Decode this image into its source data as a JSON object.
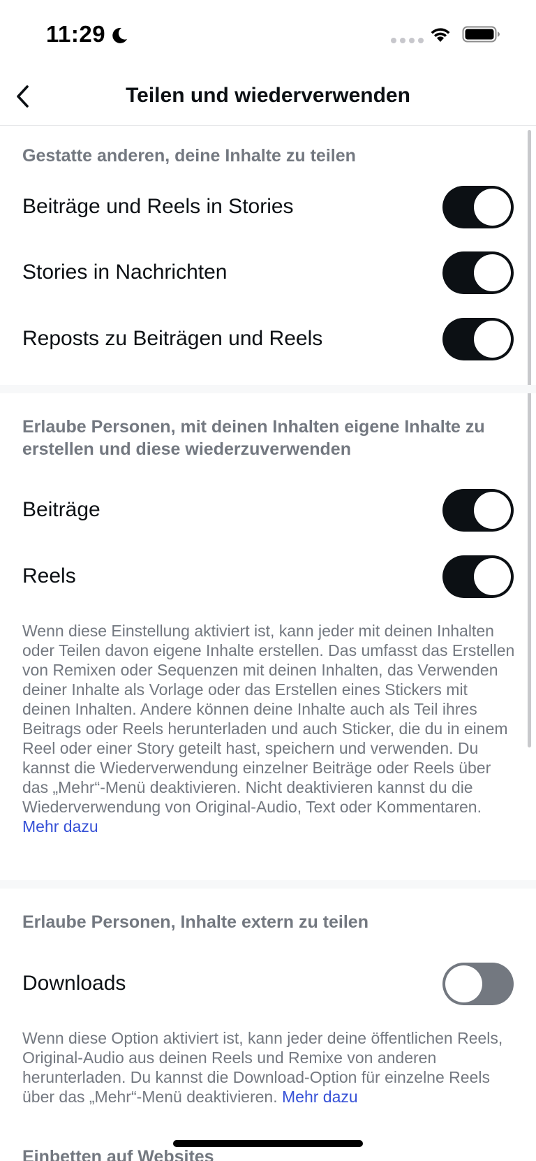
{
  "status_bar": {
    "time": "11:29"
  },
  "nav": {
    "title": "Teilen und wiederverwenden"
  },
  "section_share": {
    "header": "Gestatte anderen, deine Inhalte zu teilen",
    "items": [
      {
        "label": "Beiträge und Reels in Stories",
        "enabled": true
      },
      {
        "label": "Stories in Nachrichten",
        "enabled": true
      },
      {
        "label": "Reposts zu Beiträgen und Reels",
        "enabled": true
      }
    ]
  },
  "section_reuse": {
    "header": "Erlaube Personen, mit deinen Inhalten eigene Inhalte zu erstellen und diese wiederzuverwenden",
    "items": [
      {
        "label": "Beiträge",
        "enabled": true
      },
      {
        "label": "Reels",
        "enabled": true
      }
    ],
    "description": "Wenn diese Einstellung aktiviert ist, kann jeder mit deinen Inhalten oder Teilen davon eigene Inhalte erstellen. Das umfasst das Erstellen von Remixen oder Sequenzen mit deinen Inhalten, das Verwenden deiner Inhalte als Vorlage oder das Erstellen eines Stickers mit deinen Inhalten. Andere können deine Inhalte auch als Teil ihres Beitrags oder Reels herunterladen und auch Sticker, die du in einem Reel oder einer Story geteilt hast, speichern und verwenden. Du kannst die Wiederverwendung einzelner Beiträge oder Reels über das „Mehr“-Menü deaktivieren. Nicht deaktivieren kannst du die Wiederverwendung von Original-Audio, Text oder Kommentaren.",
    "link": "Mehr dazu"
  },
  "section_external": {
    "header": "Erlaube Personen, Inhalte extern zu teilen",
    "items": [
      {
        "label": "Downloads",
        "enabled": false
      }
    ],
    "description": "Wenn diese Option aktiviert ist, kann jeder deine öffentlichen Reels, Original-Audio aus deinen Reels und Remixe von anderen herunterladen. Du kannst die Download-Option für einzelne Reels über das „Mehr“-Menü deaktivieren.",
    "link": "Mehr dazu"
  },
  "section_embed": {
    "header": "Einbetten auf Websites"
  },
  "colors": {
    "toggle_on": "#0c1014",
    "toggle_off": "#737880",
    "link": "#3550d6",
    "secondary_text": "#737880"
  },
  "icons": {
    "back": "chevron-left-icon",
    "moon": "moon-icon",
    "wifi": "wifi-icon",
    "battery": "battery-icon"
  }
}
